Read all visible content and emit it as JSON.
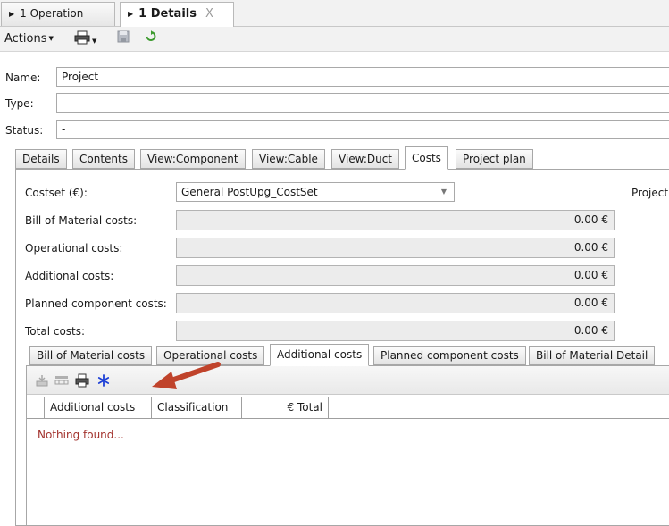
{
  "doc_tabs": [
    {
      "label": "1 Operation",
      "active": false
    },
    {
      "label": "1 Details",
      "active": true,
      "close": "X"
    }
  ],
  "toolbar": {
    "actions_label": "Actions"
  },
  "form": {
    "name_label": "Name:",
    "name_value": "Project",
    "type_label": "Type:",
    "type_value": "",
    "status_label": "Status:",
    "status_value": "-"
  },
  "main_tabs": [
    {
      "label": "Details",
      "active": false
    },
    {
      "label": "Contents",
      "active": false
    },
    {
      "label": "View:Component",
      "active": false
    },
    {
      "label": "View:Cable",
      "active": false
    },
    {
      "label": "View:Duct",
      "active": false
    },
    {
      "label": "Costs",
      "active": true
    },
    {
      "label": "Project plan",
      "active": false
    }
  ],
  "costs": {
    "costset_label": "Costset (€):",
    "costset_value": "General PostUpg_CostSet",
    "right_label": "Project",
    "rows": [
      {
        "label": "Bill of Material costs:",
        "value": "0.00 €"
      },
      {
        "label": "Operational costs:",
        "value": "0.00 €"
      },
      {
        "label": "Additional costs:",
        "value": "0.00 €"
      },
      {
        "label": "Planned component costs:",
        "value": "0.00 €"
      },
      {
        "label": "Total costs:",
        "value": "0.00 €"
      }
    ]
  },
  "sub_tabs": [
    {
      "label": "Bill of Material costs",
      "active": false
    },
    {
      "label": "Operational costs",
      "active": false
    },
    {
      "label": "Additional costs",
      "active": true
    },
    {
      "label": "Planned component costs",
      "active": false
    },
    {
      "label": "Bill of Material Detail",
      "active": false
    }
  ],
  "grid": {
    "columns": [
      "Additional costs",
      "Classification",
      "€ Total"
    ],
    "empty_text": "Nothing found..."
  },
  "colors": {
    "annotation_arrow": "#c0432b",
    "empty_text": "#a2312c",
    "add_icon": "#1c3fd6"
  },
  "icons": [
    "save-icon",
    "refresh-icon",
    "print-icon",
    "remove-row-icon",
    "columns-icon",
    "add-icon",
    "close-icon",
    "arrow-annotation"
  ]
}
